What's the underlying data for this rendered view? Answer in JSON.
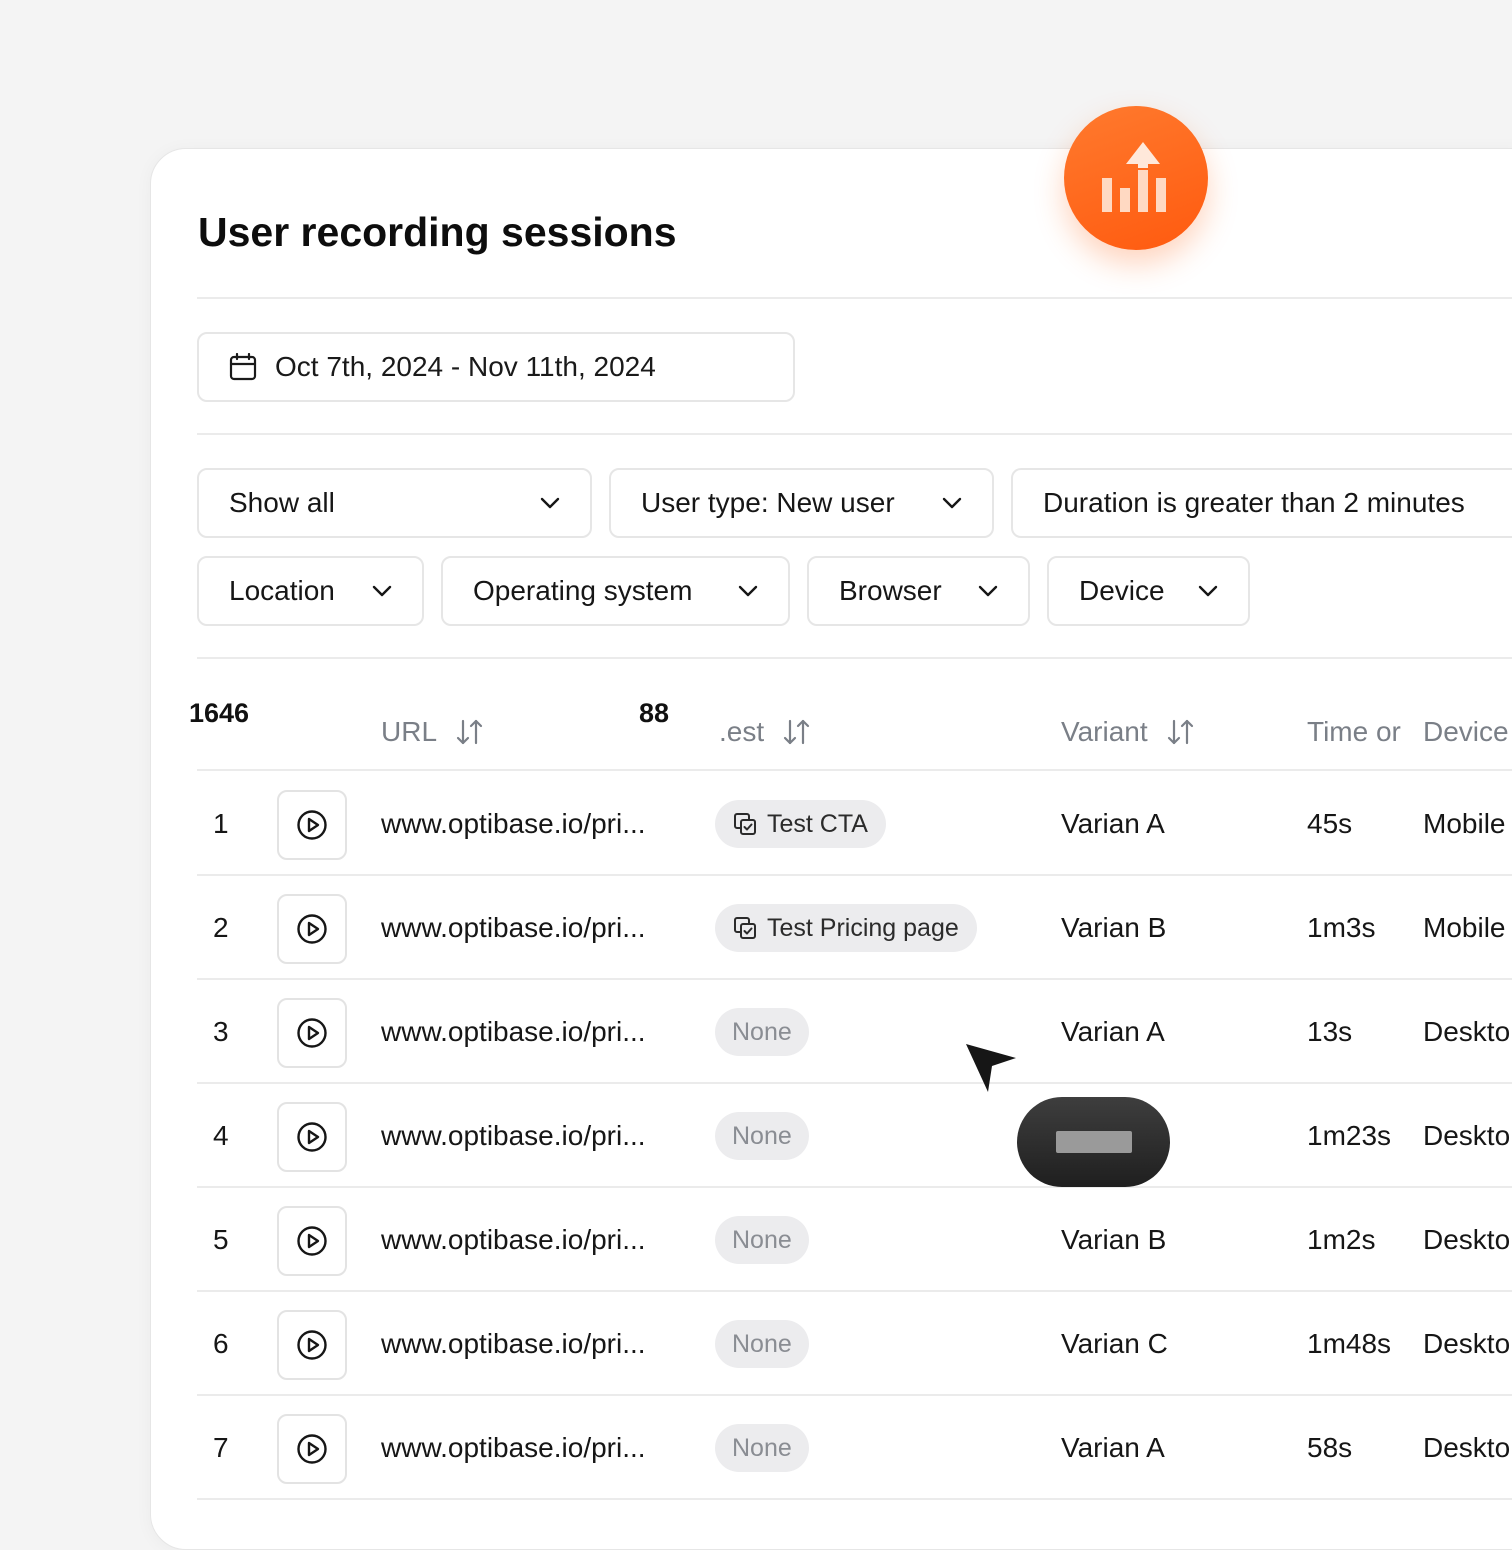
{
  "page": {
    "title": "User recording sessions"
  },
  "date_range": {
    "label": "Oct 7th, 2024 - Nov 11th, 2024",
    "icon": "calendar-icon"
  },
  "filters": {
    "show": "Show all",
    "user_type": "User type: New user",
    "duration": "Duration is greater than 2 minutes",
    "location": "Location",
    "os": "Operating system",
    "browser": "Browser",
    "device": "Device"
  },
  "counters": {
    "left": "1646",
    "middle": "88"
  },
  "table": {
    "headers": {
      "url": "URL",
      "test": ".est",
      "variant": "Variant",
      "time": "Time or",
      "device": "Device"
    },
    "rows": [
      {
        "index": "1",
        "url": "www.optibase.io/pri...",
        "test": "Test CTA",
        "test_none": false,
        "variant": "Varian A",
        "time": "45s",
        "device": "Mobile"
      },
      {
        "index": "2",
        "url": "www.optibase.io/pri...",
        "test": "Test Pricing page",
        "test_none": false,
        "variant": "Varian B",
        "time": "1m3s",
        "device": "Mobile"
      },
      {
        "index": "3",
        "url": "www.optibase.io/pri...",
        "test": "None",
        "test_none": true,
        "variant": "Varian A",
        "time": "13s",
        "device": "Deskto"
      },
      {
        "index": "4",
        "url": "www.optibase.io/pri...",
        "test": "None",
        "test_none": true,
        "variant": "",
        "time": "1m23s",
        "device": "Deskto"
      },
      {
        "index": "5",
        "url": "www.optibase.io/pri...",
        "test": "None",
        "test_none": true,
        "variant": "Varian B",
        "time": "1m2s",
        "device": "Deskto"
      },
      {
        "index": "6",
        "url": "www.optibase.io/pri...",
        "test": "None",
        "test_none": true,
        "variant": "Varian C",
        "time": "1m48s",
        "device": "Deskto"
      },
      {
        "index": "7",
        "url": "www.optibase.io/pri...",
        "test": "None",
        "test_none": true,
        "variant": "Varian A",
        "time": "58s",
        "device": "Deskto"
      }
    ]
  },
  "colors": {
    "accent": "#ff6a1a",
    "pill_bg": "#ececee",
    "border": "#e6e6e6",
    "header_text": "#7a7f87"
  }
}
